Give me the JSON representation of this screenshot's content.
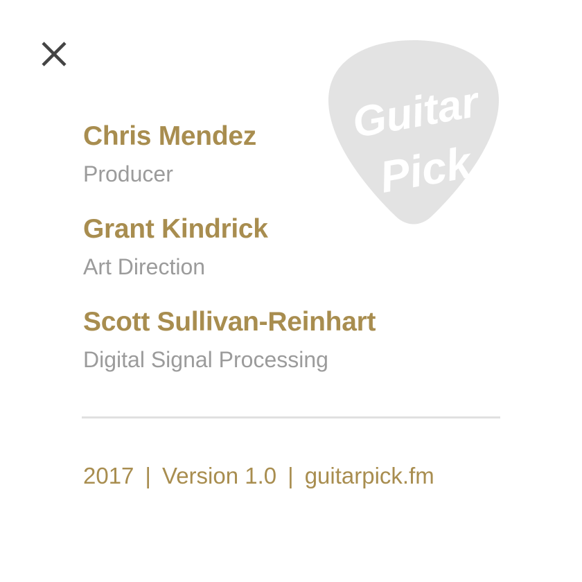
{
  "close_button": {
    "icon": "close-icon",
    "color": "#444444"
  },
  "logo": {
    "icon": "guitar-pick-logo",
    "line1": "Guitar",
    "line2": "Pick",
    "color": "#e3e3e3"
  },
  "credits": [
    {
      "name": "Chris Mendez",
      "role": "Producer"
    },
    {
      "name": "Grant Kindrick",
      "role": "Art Direction"
    },
    {
      "name": "Scott Sullivan-Reinhart",
      "role": "Digital Signal Processing"
    }
  ],
  "footer": {
    "year": "2017",
    "separator": "|",
    "version": "Version 1.0",
    "website": "guitarpick.fm"
  },
  "colors": {
    "accent": "#a88d4f",
    "secondary_text": "#9b9b9b",
    "divider": "#e0e0e0"
  }
}
